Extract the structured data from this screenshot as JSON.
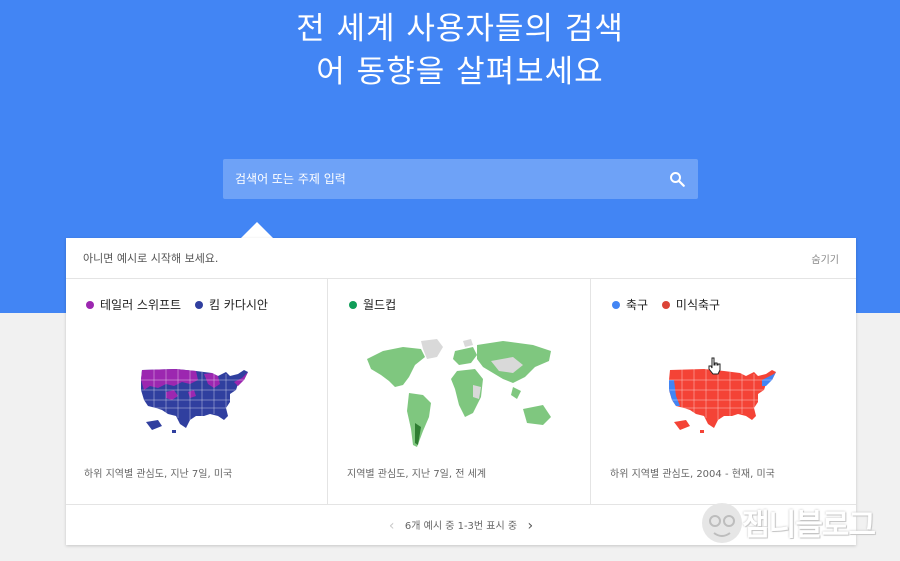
{
  "hero": {
    "title": "전 세계 사용자들의 검색어 동향을 살펴보세요",
    "search_placeholder": "검색어 또는 주제 입력",
    "search_icon": "search-icon",
    "background_color": "#4285f4"
  },
  "examples": {
    "intro": "아니면 예시로 시작해 보세요.",
    "hide_label": "숨기기",
    "cards": [
      {
        "legend": [
          {
            "label": "테일러 스위프트",
            "color": "#9c27b0"
          },
          {
            "label": "킴 카다시안",
            "color": "#303f9f"
          }
        ],
        "caption": "하위 지역별 관심도, 지난 7일, 미국"
      },
      {
        "legend": [
          {
            "label": "월드컵",
            "color": "#0f9d58"
          }
        ],
        "caption": "지역별 관심도, 지난 7일, 전 세계"
      },
      {
        "legend": [
          {
            "label": "축구",
            "color": "#4285f4"
          },
          {
            "label": "미식축구",
            "color": "#db4437"
          }
        ],
        "caption": "하위 지역별 관심도, 2004 - 현재, 미국"
      }
    ],
    "pager_text": "6개 예시 중 1-3번 표시 중"
  },
  "watermark": {
    "text": "잼니블로그"
  }
}
